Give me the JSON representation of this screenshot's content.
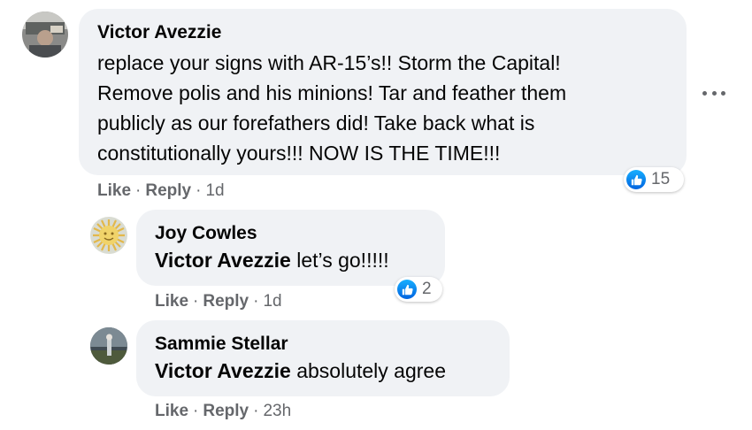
{
  "comments": [
    {
      "author": "Victor Avezzie",
      "lines": [
        "replace your signs with AR-15’s!! Storm the Capital!",
        "Remove polis and his minions! Tar and feather them",
        "publicly as our forefathers did! Take back what is",
        "constitutionally yours!!! NOW IS THE TIME!!!"
      ],
      "like_label": "Like",
      "reply_label": "Reply",
      "time": "1d",
      "reaction_count": "15"
    },
    {
      "author": "Joy Cowles",
      "mention": "Victor Avezzie",
      "text": " let’s go!!!!!",
      "like_label": "Like",
      "reply_label": "Reply",
      "time": "1d",
      "reaction_count": "2"
    },
    {
      "author": "Sammie Stellar",
      "mention": "Victor Avezzie",
      "text": " absolutely agree",
      "like_label": "Like",
      "reply_label": "Reply",
      "time": "23h"
    }
  ],
  "separator": "·",
  "colors": {
    "bubble": "#f0f2f5",
    "action_text": "#65676b",
    "like_blue": "#1877f2"
  },
  "icons": [
    "avatar",
    "like-icon",
    "more-options-icon"
  ]
}
